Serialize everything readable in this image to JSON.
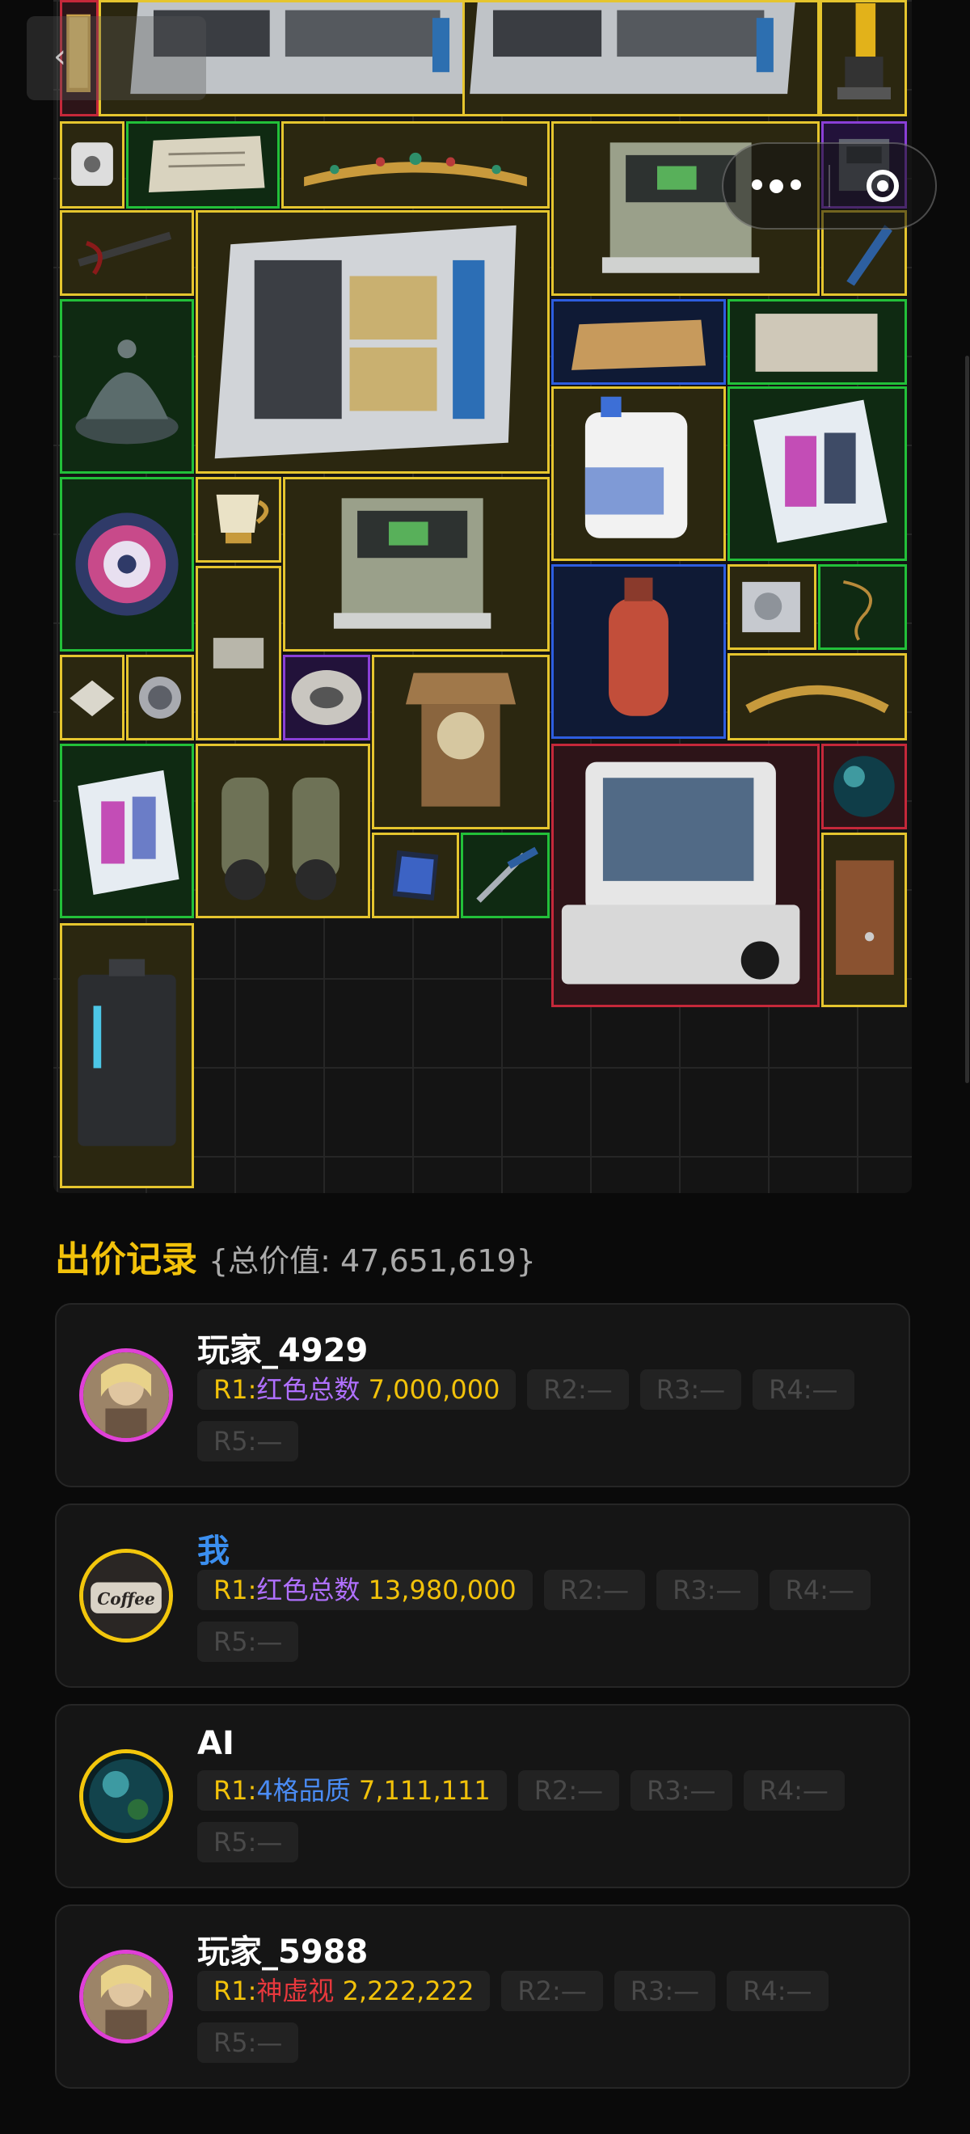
{
  "bids_section": {
    "title": "出价记录",
    "total_value_text": "{总价值: 47,651,619}"
  },
  "bids": [
    {
      "player": "玩家_4929",
      "is_me": false,
      "avatar_frame_color": "#e040d8",
      "r1": {
        "prefix": "R1:",
        "mode": "红色总数",
        "mode_color": "purple",
        "amount": "7,000,000"
      },
      "r2": "R2:—",
      "r3": "R3:—",
      "r4": "R4:—",
      "r5": "R5:—"
    },
    {
      "player": "我",
      "is_me": true,
      "avatar_frame_color": "#f2c60c",
      "r1": {
        "prefix": "R1:",
        "mode": "红色总数",
        "mode_color": "purple",
        "amount": "13,980,000"
      },
      "r2": "R2:—",
      "r3": "R3:—",
      "r4": "R4:—",
      "r5": "R5:—"
    },
    {
      "player": "AI",
      "is_me": false,
      "avatar_frame_color": "#f2c60c",
      "r1": {
        "prefix": "R1:",
        "mode": "4格品质",
        "mode_color": "blue",
        "amount": "7,111,111"
      },
      "r2": "R2:—",
      "r3": "R3:—",
      "r4": "R4:—",
      "r5": "R5:—"
    },
    {
      "player": "玩家_5988",
      "is_me": false,
      "avatar_frame_color": "#e040d8",
      "r1": {
        "prefix": "R1:",
        "mode": "神虚视",
        "mode_color": "red",
        "amount": "2,222,222"
      },
      "r2": "R2:—",
      "r3": "R3:—",
      "r4": "R4:—",
      "r5": "R5:—"
    }
  ],
  "colors": {
    "accent_gold": "#f2c20a",
    "quality_yellow": "#e5c52e",
    "quality_green": "#22c039",
    "quality_blue": "#2d5de0",
    "quality_purple": "#8a3fd6",
    "quality_red": "#c5283a",
    "me_blue": "#3b8ff0"
  },
  "icons": {
    "capsule_menu": "more-dots-icon",
    "capsule_close": "target-close-icon",
    "back": "back-arrow-icon"
  }
}
